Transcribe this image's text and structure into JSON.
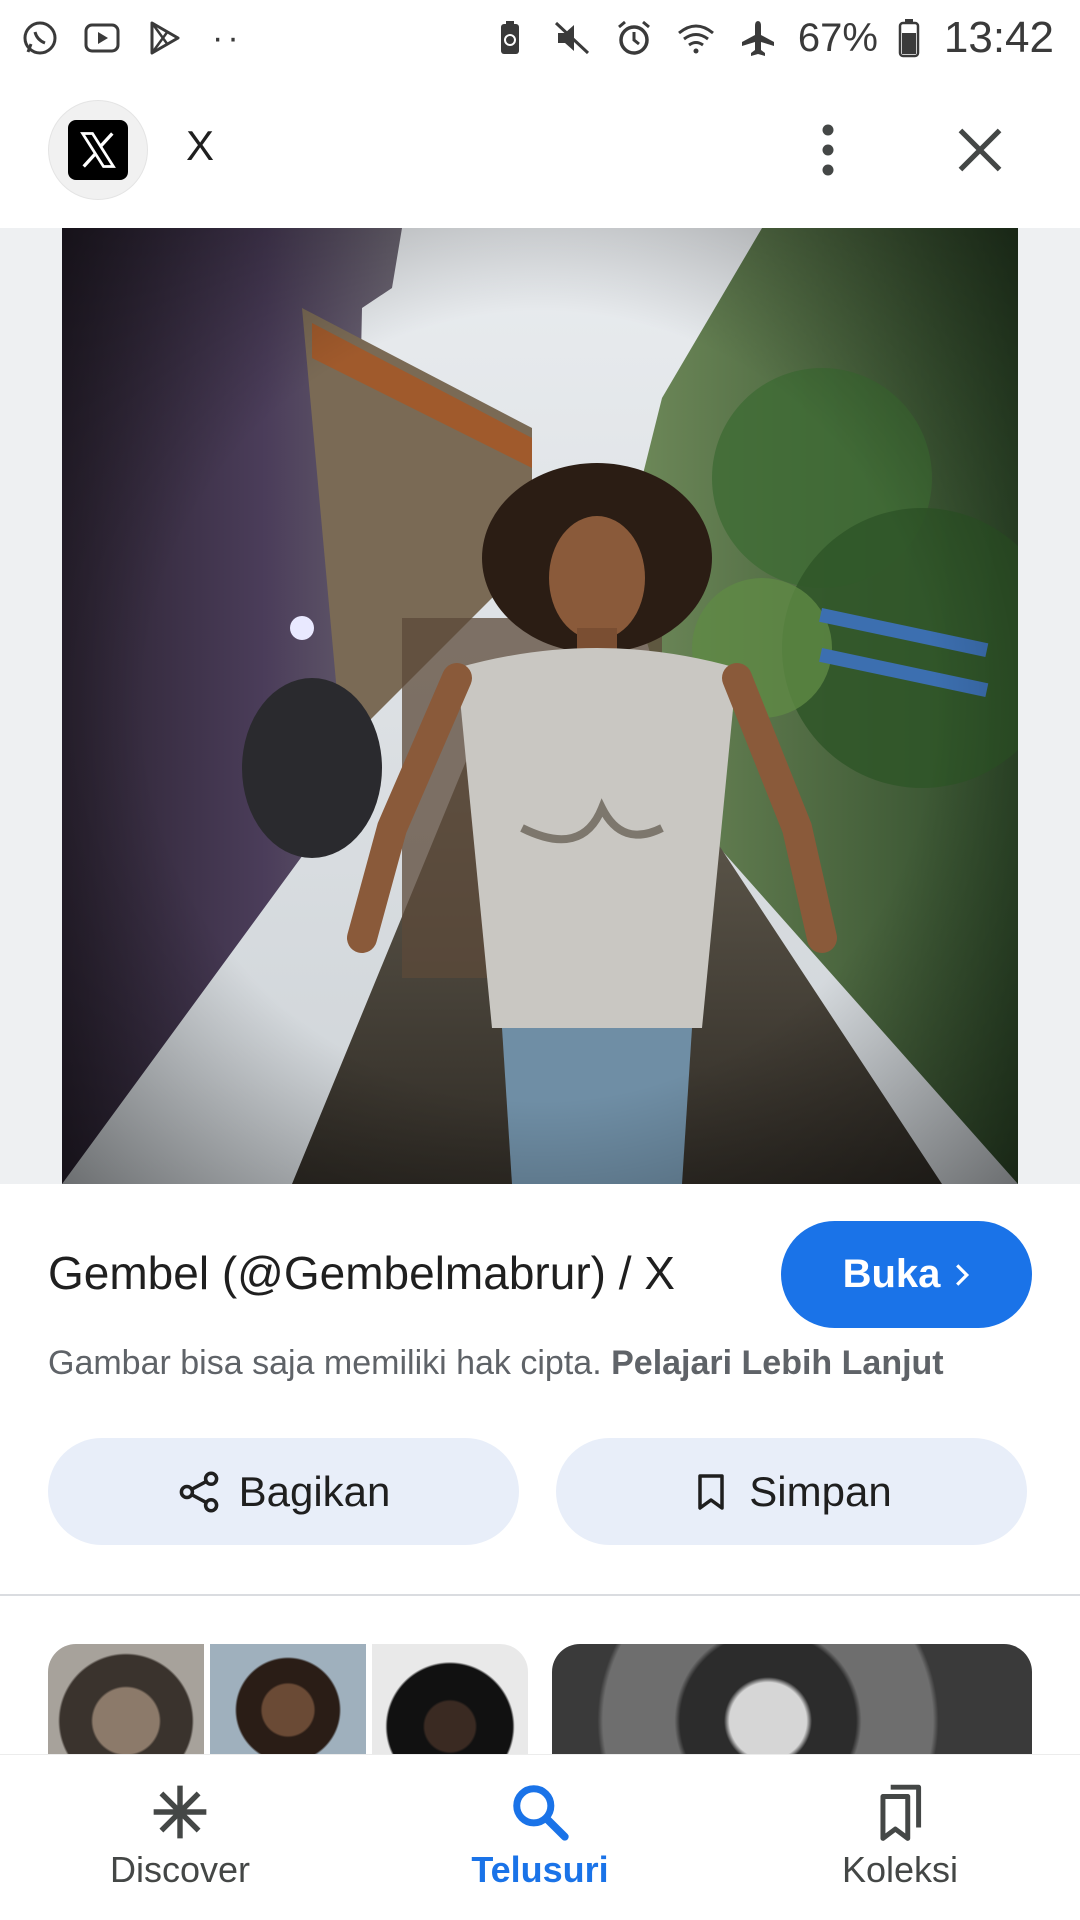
{
  "status_bar": {
    "battery_percent": "67%",
    "time": "13:42",
    "left_icons": [
      "whatsapp-icon",
      "youtube-icon",
      "play-store-icon"
    ],
    "right_icons": [
      "battery-saver-icon",
      "mute-icon",
      "alarm-icon",
      "wifi-icon",
      "airplane-icon",
      "battery-icon"
    ]
  },
  "header": {
    "site_name": "X"
  },
  "result": {
    "title": "Gembel (@Gembelmabrur) / X",
    "open_label": "Buka",
    "copyright_text": "Gambar bisa saja memiliki hak cipta.",
    "learn_more_label": "Pelajari Lebih Lanjut"
  },
  "actions": {
    "share_label": "Bagikan",
    "save_label": "Simpan"
  },
  "bottom_nav": {
    "items": [
      {
        "label": "Discover",
        "icon": "asterisk-icon"
      },
      {
        "label": "Telusuri",
        "icon": "search-icon",
        "active": true
      },
      {
        "label": "Koleksi",
        "icon": "collections-icon"
      }
    ]
  },
  "colors": {
    "accent": "#1a73e8",
    "chip_background": "#e8eef9"
  }
}
